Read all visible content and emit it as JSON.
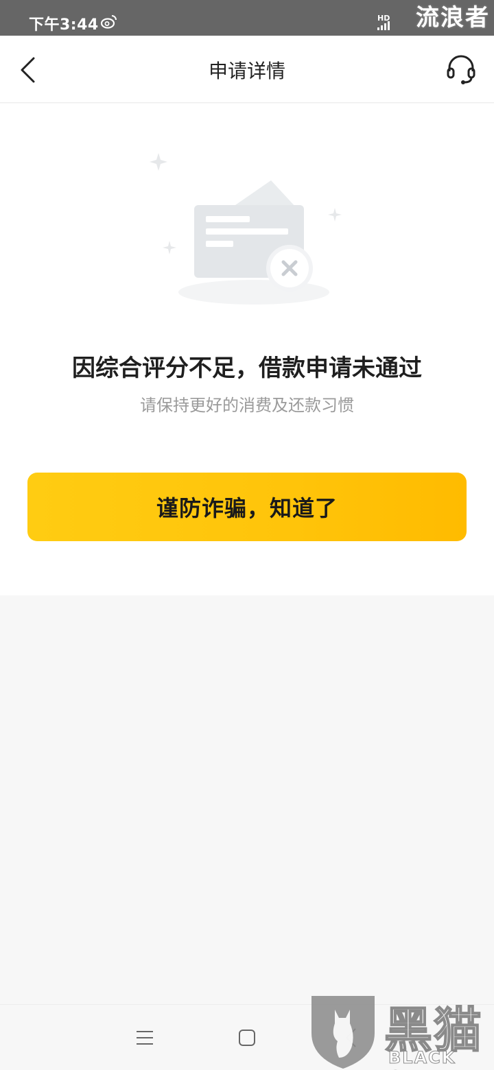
{
  "status_bar": {
    "time": "下午3:44",
    "network": "HD",
    "watermark": "流浪者",
    "icons": [
      "weibo-icon",
      "signal-icon"
    ]
  },
  "header": {
    "title": "申请详情",
    "icons": [
      "back-arrow-icon",
      "headset-icon"
    ]
  },
  "result": {
    "title": "因综合评分不足，借款申请未通过",
    "subtitle": "请保持更好的消费及还款习惯",
    "illustration": "application-rejected-card-icon",
    "button_label": "谨防诈骗，知道了"
  },
  "colors": {
    "button": "#FFC40A",
    "title": "#1F1F1F",
    "subtitle": "#9A9A9A",
    "status_bar": "#666666"
  },
  "nav_bar": {
    "icons": [
      "menu-icon",
      "home-square-icon",
      "back-triangle-icon"
    ]
  },
  "watermark": {
    "cn": "黑猫",
    "en": "BLACK CAT"
  }
}
